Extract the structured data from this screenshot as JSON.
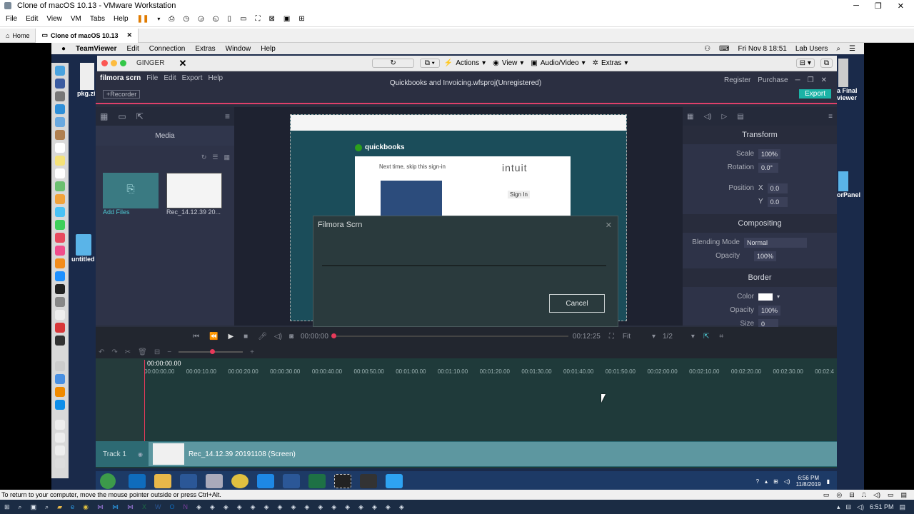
{
  "vmware": {
    "title": "Clone of macOS 10.13 - VMware Workstation",
    "menu": [
      "File",
      "Edit",
      "View",
      "VM",
      "Tabs",
      "Help"
    ],
    "tabs": [
      {
        "label": "Home"
      },
      {
        "label": "Clone of macOS 10.13"
      }
    ]
  },
  "mac_menubar": {
    "app": "TeamViewer",
    "items": [
      "Edit",
      "Connection",
      "Extras",
      "Window",
      "Help"
    ],
    "datetime": "Fri Nov 8  18:51",
    "user": "Lab Users"
  },
  "teamviewer": {
    "session_name": "GINGER",
    "actions_label": "Actions",
    "view_label": "View",
    "audio_label": "Audio/Video",
    "extras_label": "Extras"
  },
  "desktop_icons": [
    {
      "label": "pkg.zi"
    },
    {
      "label": "untitled"
    },
    {
      "label": "a Final\nviewer"
    },
    {
      "label": "orPanel"
    }
  ],
  "filmora": {
    "logo": "filmora scrn",
    "menu": [
      "File",
      "Edit",
      "Export",
      "Help"
    ],
    "project_title": "Quickbooks and Invoicing.wfsproj(Unregistered)",
    "register": "Register",
    "purchase": "Purchase",
    "recorder_btn": "+Recorder",
    "export_btn": "Export",
    "media_tab": "Media",
    "media_items": [
      {
        "label": "Add Files"
      },
      {
        "label": "Rec_14.12.39 20..."
      }
    ],
    "preview": {
      "logo_text": "quickbooks",
      "intuit": "intuit",
      "skip_text": "Next time, skip this sign-in",
      "sign_in": "Sign In"
    },
    "transform": {
      "header": "Transform",
      "scale_label": "Scale",
      "scale": "100%",
      "rotation_label": "Rotation",
      "rotation": "0.0°",
      "position_label": "Position",
      "x_label": "X",
      "x": "0.0",
      "y_label": "Y",
      "y": "0.0"
    },
    "compositing": {
      "header": "Compositing",
      "blend_label": "Blending Mode",
      "blend": "Normal",
      "opacity_label": "Opacity",
      "opacity": "100%"
    },
    "border": {
      "header": "Border",
      "color_label": "Color",
      "opacity_label": "Opacity",
      "opacity": "100%",
      "size_label": "Size",
      "size": "0"
    },
    "playback": {
      "current": "00:00:00",
      "end": "00:12:25",
      "fit": "Fit",
      "ratio": "1/2"
    },
    "timeline": {
      "playhead": "00:00:00.00",
      "ticks": [
        "00:00:00.00",
        "00:00:10.00",
        "00:00:20.00",
        "00:00:30.00",
        "00:00:40.00",
        "00:00:50.00",
        "00:01:00.00",
        "00:01:10.00",
        "00:01:20.00",
        "00:01:30.00",
        "00:01:40.00",
        "00:01:50.00",
        "00:02:00.00",
        "00:02:10.00",
        "00:02:20.00",
        "00:02:30.00",
        "00:02:4"
      ],
      "track_label": "Track 1",
      "clip_label": "Rec_14.12.39 20191108 (Screen)"
    },
    "dialog": {
      "title": "Filmora Scrn",
      "cancel": "Cancel"
    }
  },
  "guest_tray": {
    "time": "6:56 PM",
    "date": "11/8/2019"
  },
  "status_hint": "To return to your computer, move the mouse pointer outside or press Ctrl+Alt.",
  "host_tray": {
    "time": "6:51 PM"
  }
}
